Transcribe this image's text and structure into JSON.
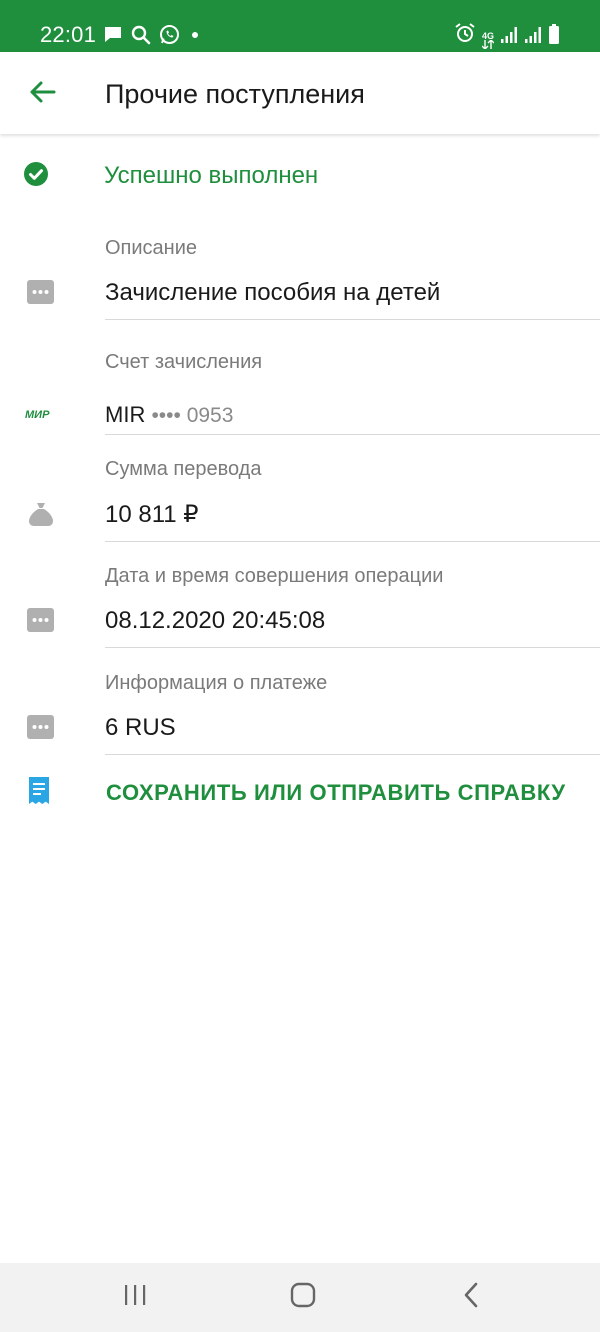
{
  "status_bar": {
    "time": "22:01",
    "network": "4G"
  },
  "app_bar": {
    "title": "Прочие поступления"
  },
  "operation": {
    "status": "Успешно выполнен"
  },
  "details": {
    "description": {
      "label": "Описание",
      "value": "Зачисление пособия на детей"
    },
    "account": {
      "label": "Счет зачисления",
      "card_brand_logo": "МИР",
      "card_name": "MIR",
      "masked": "•••• 0953"
    },
    "amount": {
      "label": "Сумма перевода",
      "value": "10 811 ₽"
    },
    "datetime": {
      "label": "Дата и время совершения операции",
      "value": "08.12.2020 20:45:08"
    },
    "payment_info": {
      "label": "Информация о платеже",
      "value": "6 RUS"
    }
  },
  "action": {
    "label": "СОХРАНИТЬ ИЛИ ОТПРАВИТЬ СПРАВКУ"
  },
  "icons": {
    "back": "arrow-left-icon",
    "success": "check-circle-icon",
    "more": "dots-icon",
    "card": "mir-logo-icon",
    "money": "money-bag-icon",
    "receipt": "receipt-icon"
  },
  "colors": {
    "brand_green": "#1f8f3e",
    "receipt_blue": "#29a6e3",
    "icon_gray": "#b0b0b0"
  }
}
